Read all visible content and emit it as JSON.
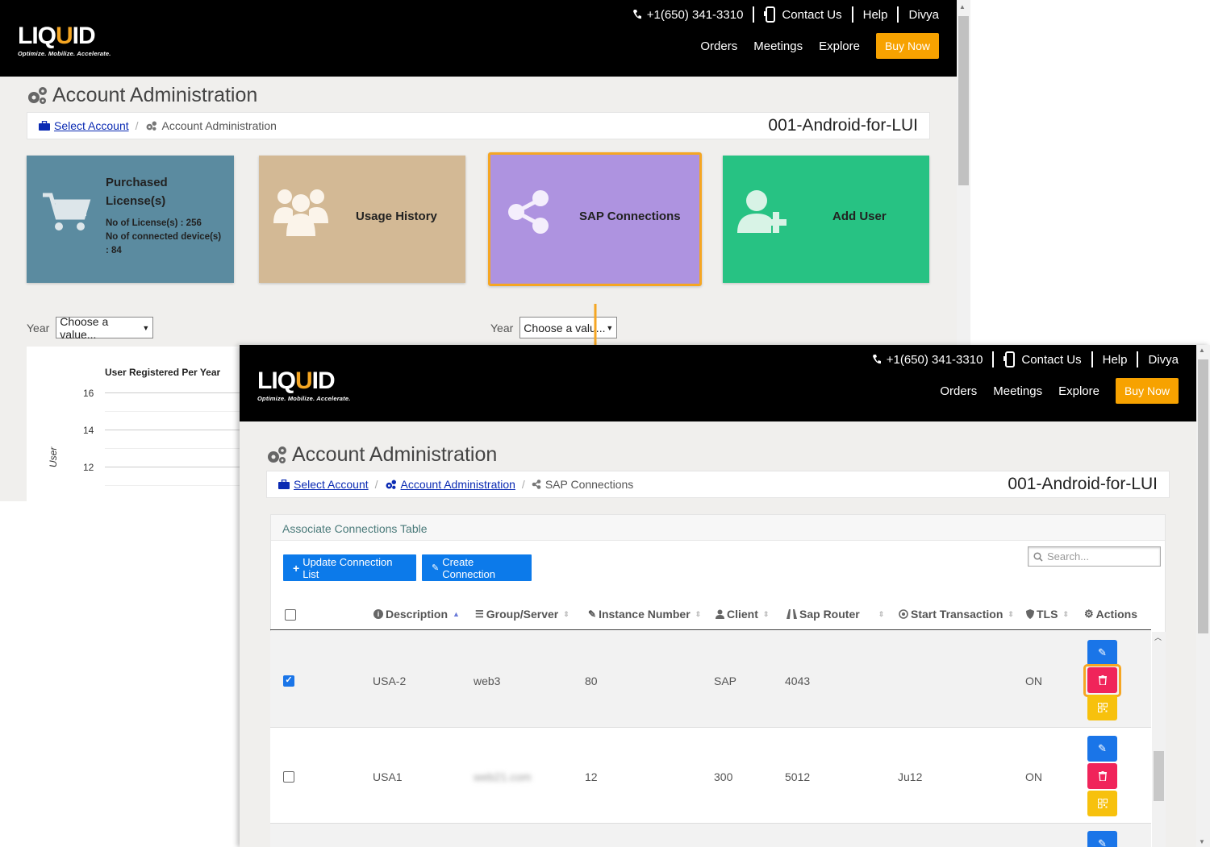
{
  "brand": {
    "logo_pre": "LIQ",
    "logo_u": "U",
    "logo_post": "ID",
    "tagline": "Optimize. Mobilize. Accelerate."
  },
  "topbar": {
    "phone": "+1(650) 341-3310",
    "contact": "Contact Us",
    "help": "Help",
    "user": "Divya"
  },
  "nav": {
    "orders": "Orders",
    "meetings": "Meetings",
    "explore": "Explore",
    "buy_now": "Buy Now"
  },
  "page_title": "Account Administration",
  "screen1": {
    "breadcrumb": {
      "select_account": "Select Account",
      "current": "Account Administration"
    },
    "account_name": "001-Android-for-LUI",
    "tiles": {
      "purchased": {
        "title": "Purchased License(s)",
        "licenses": "No of License(s) : 256",
        "devices": "No of connected device(s) : 84"
      },
      "usage": {
        "title": "Usage History"
      },
      "sap": {
        "title": "SAP Connections"
      },
      "adduser": {
        "title": "Add User"
      }
    },
    "year_label": "Year",
    "year_select_1": "Choose a value...",
    "year_select_2": "Choose a valu...",
    "chart": {
      "title": "User Registered Per Year",
      "y_label": "User",
      "y_ticks": [
        "16",
        "14",
        "12"
      ]
    }
  },
  "screen2": {
    "breadcrumb": {
      "select_account": "Select Account",
      "account_admin": "Account Administration",
      "current": "SAP Connections"
    },
    "account_name": "001-Android-for-LUI",
    "panel_title": "Associate Connections Table",
    "buttons": {
      "update": "Update Connection List",
      "create": "Create Connection"
    },
    "search_placeholder": "Search...",
    "columns": [
      "Description",
      "Group/Server",
      "Instance Number",
      "Client",
      "Sap Router",
      "Start Transaction",
      "TLS",
      "Actions"
    ],
    "rows": [
      {
        "checked": true,
        "description": "USA-2",
        "group_server": "web3",
        "instance": "80",
        "client": "SAP",
        "sap_router": "4043",
        "start_transaction": "",
        "tls": "ON"
      },
      {
        "checked": false,
        "description": "USA1",
        "group_server": "web21.com",
        "instance": "12",
        "client": "300",
        "sap_router": "5012",
        "start_transaction": "Ju12",
        "tls": "ON"
      }
    ]
  },
  "colors": {
    "accent": "#f7a200",
    "purchased": "#5b8ba0",
    "usage": "#d3b995",
    "sap": "#ae93e0",
    "adduser": "#27c283",
    "primary_btn": "#0c7aea",
    "delete": "#f0245a",
    "qr": "#f7c10d"
  }
}
